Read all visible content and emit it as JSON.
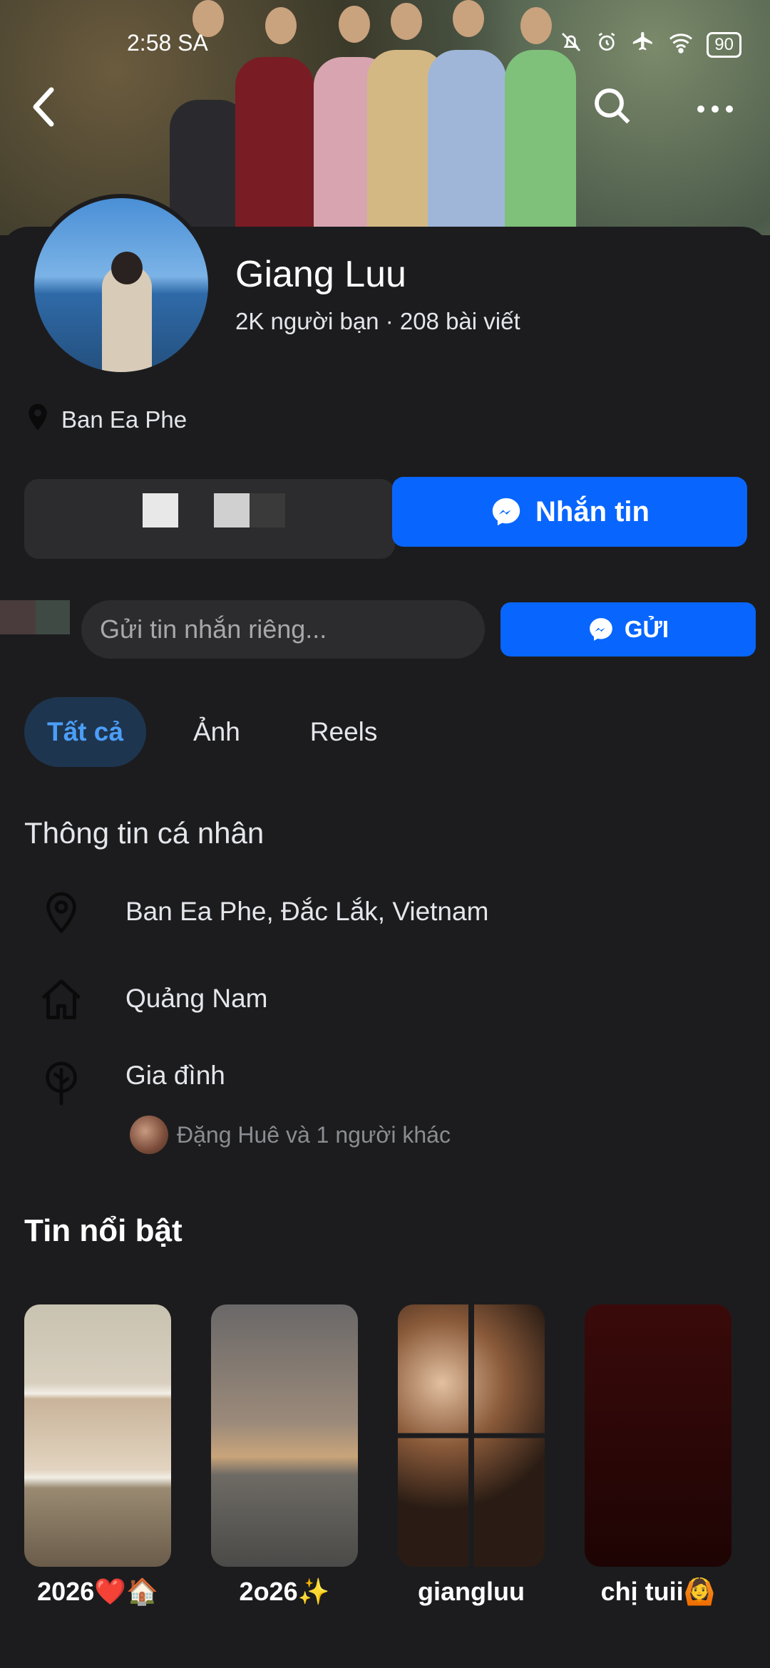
{
  "status_bar": {
    "time": "2:58 SA",
    "battery": "90",
    "icons": [
      "bell-off-icon",
      "alarm-icon",
      "airplane-icon",
      "wifi-icon",
      "battery-icon"
    ]
  },
  "profile": {
    "name": "Giang Luu",
    "stats": "2K người bạn · 208 bài viết",
    "location_short": "Ban Ea Phe"
  },
  "actions": {
    "message_label": "Nhắn tin",
    "private_placeholder": "Gửi tin nhắn riêng...",
    "send_label": "GỬI"
  },
  "tabs": [
    {
      "label": "Tất cả",
      "active": true
    },
    {
      "label": "Ảnh",
      "active": false
    },
    {
      "label": "Reels",
      "active": false
    }
  ],
  "about": {
    "title": "Thông tin cá nhân",
    "lives_in": "Ban Ea Phe, Đắc Lắk, Vietnam",
    "hometown": "Quảng Nam",
    "family_label": "Gia đình",
    "family_members": "Đặng Huê và 1 người khác"
  },
  "highlights": {
    "title": "Tin nổi bật",
    "items": [
      {
        "label": "2026❤️🏠"
      },
      {
        "label": "2o26✨"
      },
      {
        "label": "giangluu"
      },
      {
        "label": "chị tuii🙆"
      }
    ]
  },
  "colors": {
    "background": "#1c1c1e",
    "accent": "#0866ff",
    "active_tab_bg": "#1e3550",
    "active_tab_text": "#4b9ef7"
  }
}
